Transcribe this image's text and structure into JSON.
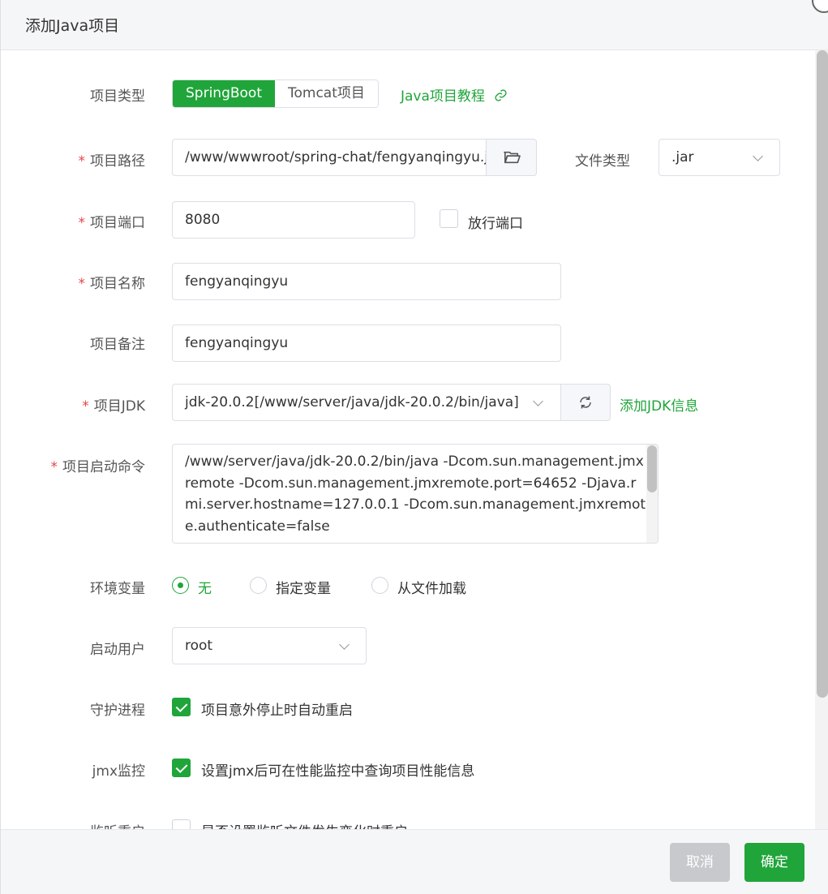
{
  "dialog": {
    "title": "添加Java项目"
  },
  "form": {
    "project_type": {
      "label": "项目类型",
      "options": [
        "SpringBoot",
        "Tomcat项目"
      ],
      "selected": "SpringBoot",
      "tutorial_link": "Java项目教程"
    },
    "project_path": {
      "label": "项目路径",
      "value": "/www/wwwroot/spring-chat/fengyanqingyu.jar",
      "file_type_label": "文件类型",
      "file_type_value": ".jar"
    },
    "project_port": {
      "label": "项目端口",
      "value": "8080",
      "release_port_label": "放行端口",
      "release_port_checked": false
    },
    "project_name": {
      "label": "项目名称",
      "value": "fengyanqingyu"
    },
    "project_remark": {
      "label": "项目备注",
      "value": "fengyanqingyu"
    },
    "project_jdk": {
      "label": "项目JDK",
      "value": "jdk-20.0.2[/www/server/java/jdk-20.0.2/bin/java]",
      "add_link": "添加JDK信息"
    },
    "start_command": {
      "label": "项目启动命令",
      "value": "/www/server/java/jdk-20.0.2/bin/java -Dcom.sun.management.jmxremote -Dcom.sun.management.jmxremote.port=64652 -Djava.rmi.server.hostname=127.0.0.1 -Dcom.sun.management.jmxremote.authenticate=false"
    },
    "env_vars": {
      "label": "环境变量",
      "options": [
        "无",
        "指定变量",
        "从文件加载"
      ],
      "selected": "无"
    },
    "start_user": {
      "label": "启动用户",
      "value": "root"
    },
    "daemon": {
      "label": "守护进程",
      "text": "项目意外停止时自动重启",
      "checked": true
    },
    "jmx": {
      "label": "jmx监控",
      "text": "设置jmx后可在性能监控中查询项目性能信息",
      "checked": true
    },
    "watch_restart": {
      "label": "监听重启",
      "text": "是否设置监听文件发生变化时重启",
      "checked": false
    }
  },
  "footer": {
    "cancel_label": "取消",
    "confirm_label": "确定"
  },
  "colors": {
    "accent": "#20a53a",
    "required": "#e64545",
    "disabled": "#c8c9cc"
  },
  "icons": [
    "folder-open-icon",
    "chevron-down-icon",
    "refresh-icon",
    "link-icon",
    "close-icon",
    "check-icon"
  ]
}
